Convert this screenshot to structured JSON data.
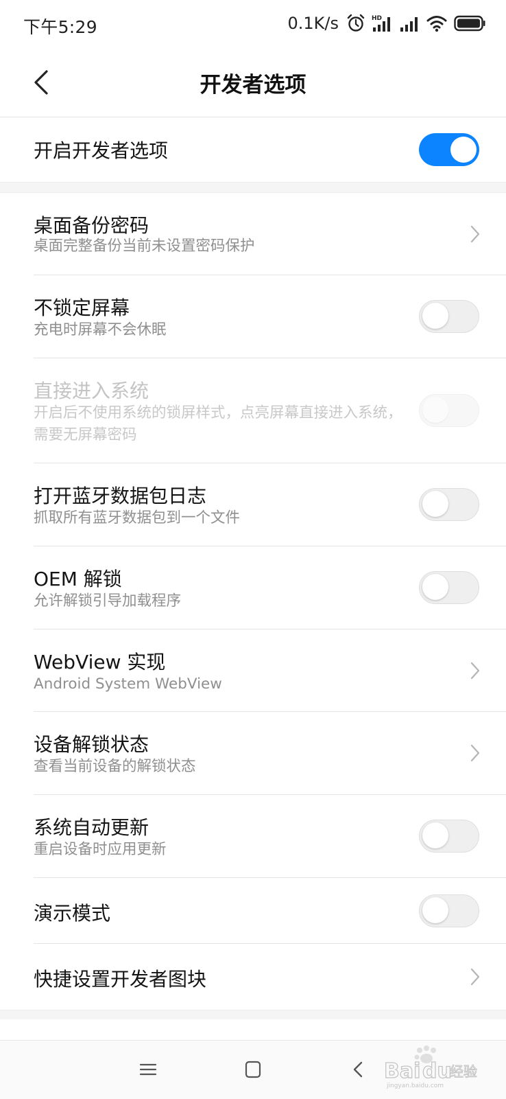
{
  "status_bar": {
    "time": "下午5:29",
    "net_speed": "0.1K/s",
    "icons": [
      "alarm-icon",
      "hd-signal-icon",
      "signal-icon",
      "wifi-icon",
      "battery-icon"
    ],
    "hd_label": "HD"
  },
  "header": {
    "title": "开发者选项",
    "back_icon": "chevron-left-icon"
  },
  "master_toggle": {
    "label": "开启开发者选项",
    "enabled": true
  },
  "settings": [
    {
      "title": "桌面备份密码",
      "subtitle": "桌面完整备份当前未设置密码保护",
      "control": "chevron"
    },
    {
      "title": "不锁定屏幕",
      "subtitle": "充电时屏幕不会休眠",
      "control": "switch",
      "on": false
    },
    {
      "title": "直接进入系统",
      "subtitle": "开启后不使用系统的锁屏样式，点亮屏幕直接进入系统，需要无屏幕密码",
      "control": "switch",
      "on": false,
      "disabled": true
    },
    {
      "title": "打开蓝牙数据包日志",
      "subtitle": "抓取所有蓝牙数据包到一个文件",
      "control": "switch",
      "on": false
    },
    {
      "title": "OEM 解锁",
      "subtitle": "允许解锁引导加载程序",
      "control": "switch",
      "on": false
    },
    {
      "title": "WebView 实现",
      "subtitle": "Android System WebView",
      "control": "chevron"
    },
    {
      "title": "设备解锁状态",
      "subtitle": "查看当前设备的解锁状态",
      "control": "chevron"
    },
    {
      "title": "系统自动更新",
      "subtitle": "重启设备时应用更新",
      "control": "switch",
      "on": false
    },
    {
      "title": "演示模式",
      "subtitle": "",
      "control": "switch",
      "on": false
    },
    {
      "title": "快捷设置开发者图块",
      "subtitle": "",
      "control": "chevron"
    }
  ],
  "nav_bar": {
    "icons": [
      "menu-icon",
      "home-square-icon",
      "back-triangle-icon"
    ]
  },
  "watermark": {
    "brand": "Bai",
    "brand_suffix": "du",
    "cn": "经验",
    "url": "jingyan.baidu.com"
  },
  "colors": {
    "accent": "#0d84ff",
    "switch_off": "#efefef",
    "divider": "#e4e4e4",
    "subtitle": "#8f8f8f"
  }
}
